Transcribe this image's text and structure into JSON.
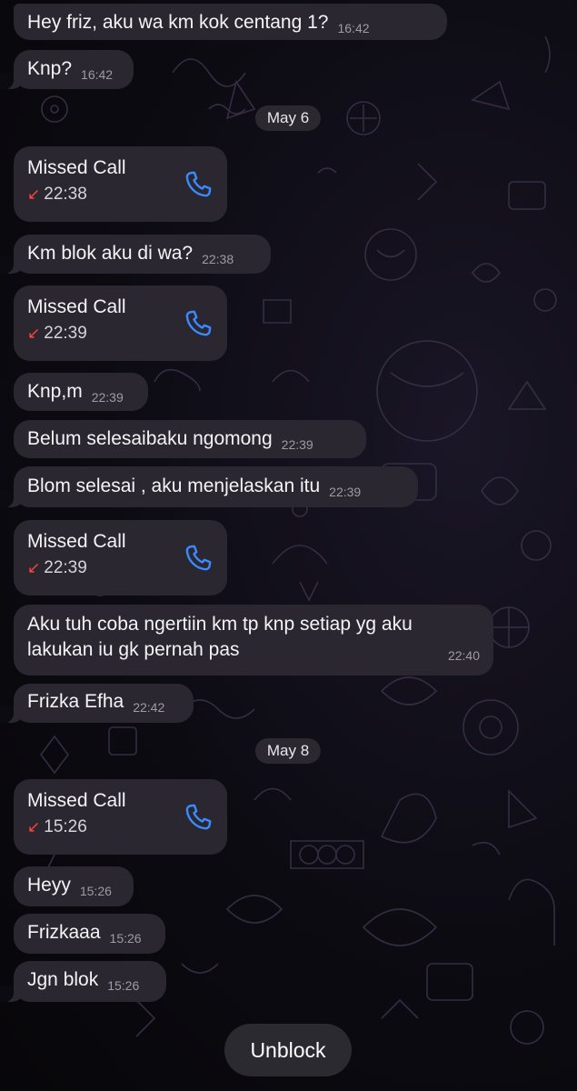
{
  "messages": [
    {
      "text": "Hey friz, aku wa km kok centang 1?",
      "time": "16:42"
    },
    {
      "text": "Knp?",
      "time": "16:42"
    },
    {
      "text": "Km blok aku di wa?",
      "time": "22:38"
    },
    {
      "text": "Knp,m",
      "time": "22:39"
    },
    {
      "text": "Belum selesaibaku ngomong",
      "time": "22:39"
    },
    {
      "text": "Blom selesai , aku menjelaskan itu",
      "time": "22:39"
    },
    {
      "line1": "Aku tuh coba ngertiin km tp knp setiap yg aku",
      "line2": "lakukan iu gk pernah pas",
      "time": "22:40"
    },
    {
      "text": "Frizka Efha",
      "time": "22:42"
    },
    {
      "text": "Heyy",
      "time": "15:26"
    },
    {
      "text": "Frizkaaa",
      "time": "15:26"
    },
    {
      "text": "Jgn blok",
      "time": "15:26"
    }
  ],
  "calls": [
    {
      "title": "Missed Call",
      "time": "22:38"
    },
    {
      "title": "Missed Call",
      "time": "22:39"
    },
    {
      "title": "Missed Call",
      "time": "22:39"
    },
    {
      "title": "Missed Call",
      "time": "15:26"
    }
  ],
  "dates": [
    "May 6",
    "May 8"
  ],
  "missed_arrow": "↙",
  "unblock_label": "Unblock",
  "icons": {
    "phone": "phone-icon",
    "missed_call": "missed-call-arrow-icon"
  },
  "colors": {
    "bubble": "#2a2730",
    "missed_red": "#ff453a",
    "phone_blue": "#3a8bff",
    "background": "#0b0a10"
  }
}
